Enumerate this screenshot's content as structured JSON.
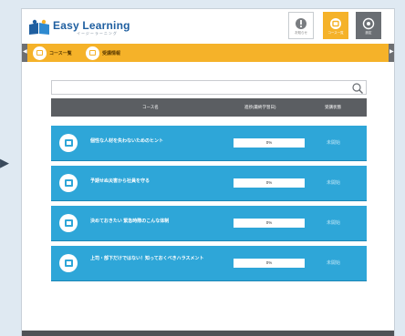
{
  "header": {
    "logo_title": "Easy Learning",
    "logo_sub": "イージーラーニング",
    "buttons": [
      {
        "label": "お知らせ",
        "icon": "exclamation-icon"
      },
      {
        "label": "コース一覧",
        "icon": "course-icon"
      },
      {
        "label": "設定",
        "icon": "gear-icon"
      }
    ]
  },
  "breadcrumb": [
    {
      "label": "コース一覧"
    },
    {
      "label": "受講情報"
    }
  ],
  "search": {
    "value": "",
    "placeholder": ""
  },
  "table": {
    "columns": [
      "コース名",
      "進捗(最終学習日)",
      "受講状態"
    ],
    "rows": [
      {
        "title": "個性な人材を失わないためのヒント",
        "progress": 0,
        "progress_text": "0%",
        "status": "未開始"
      },
      {
        "title": "予期せぬ災害から社員を守る",
        "progress": 0,
        "progress_text": "0%",
        "status": "未開始"
      },
      {
        "title": "決めておきたい 緊急時際のこんな体制",
        "progress": 0,
        "progress_text": "0%",
        "status": "未開始"
      },
      {
        "title": "上司・部下だけではない！知っておくべきハラスメント",
        "progress": 0,
        "progress_text": "0%",
        "status": "未開始"
      }
    ]
  },
  "colors": {
    "accent": "#f5b229",
    "row": "#2ea6d8",
    "header_dark": "#5b5e62"
  }
}
